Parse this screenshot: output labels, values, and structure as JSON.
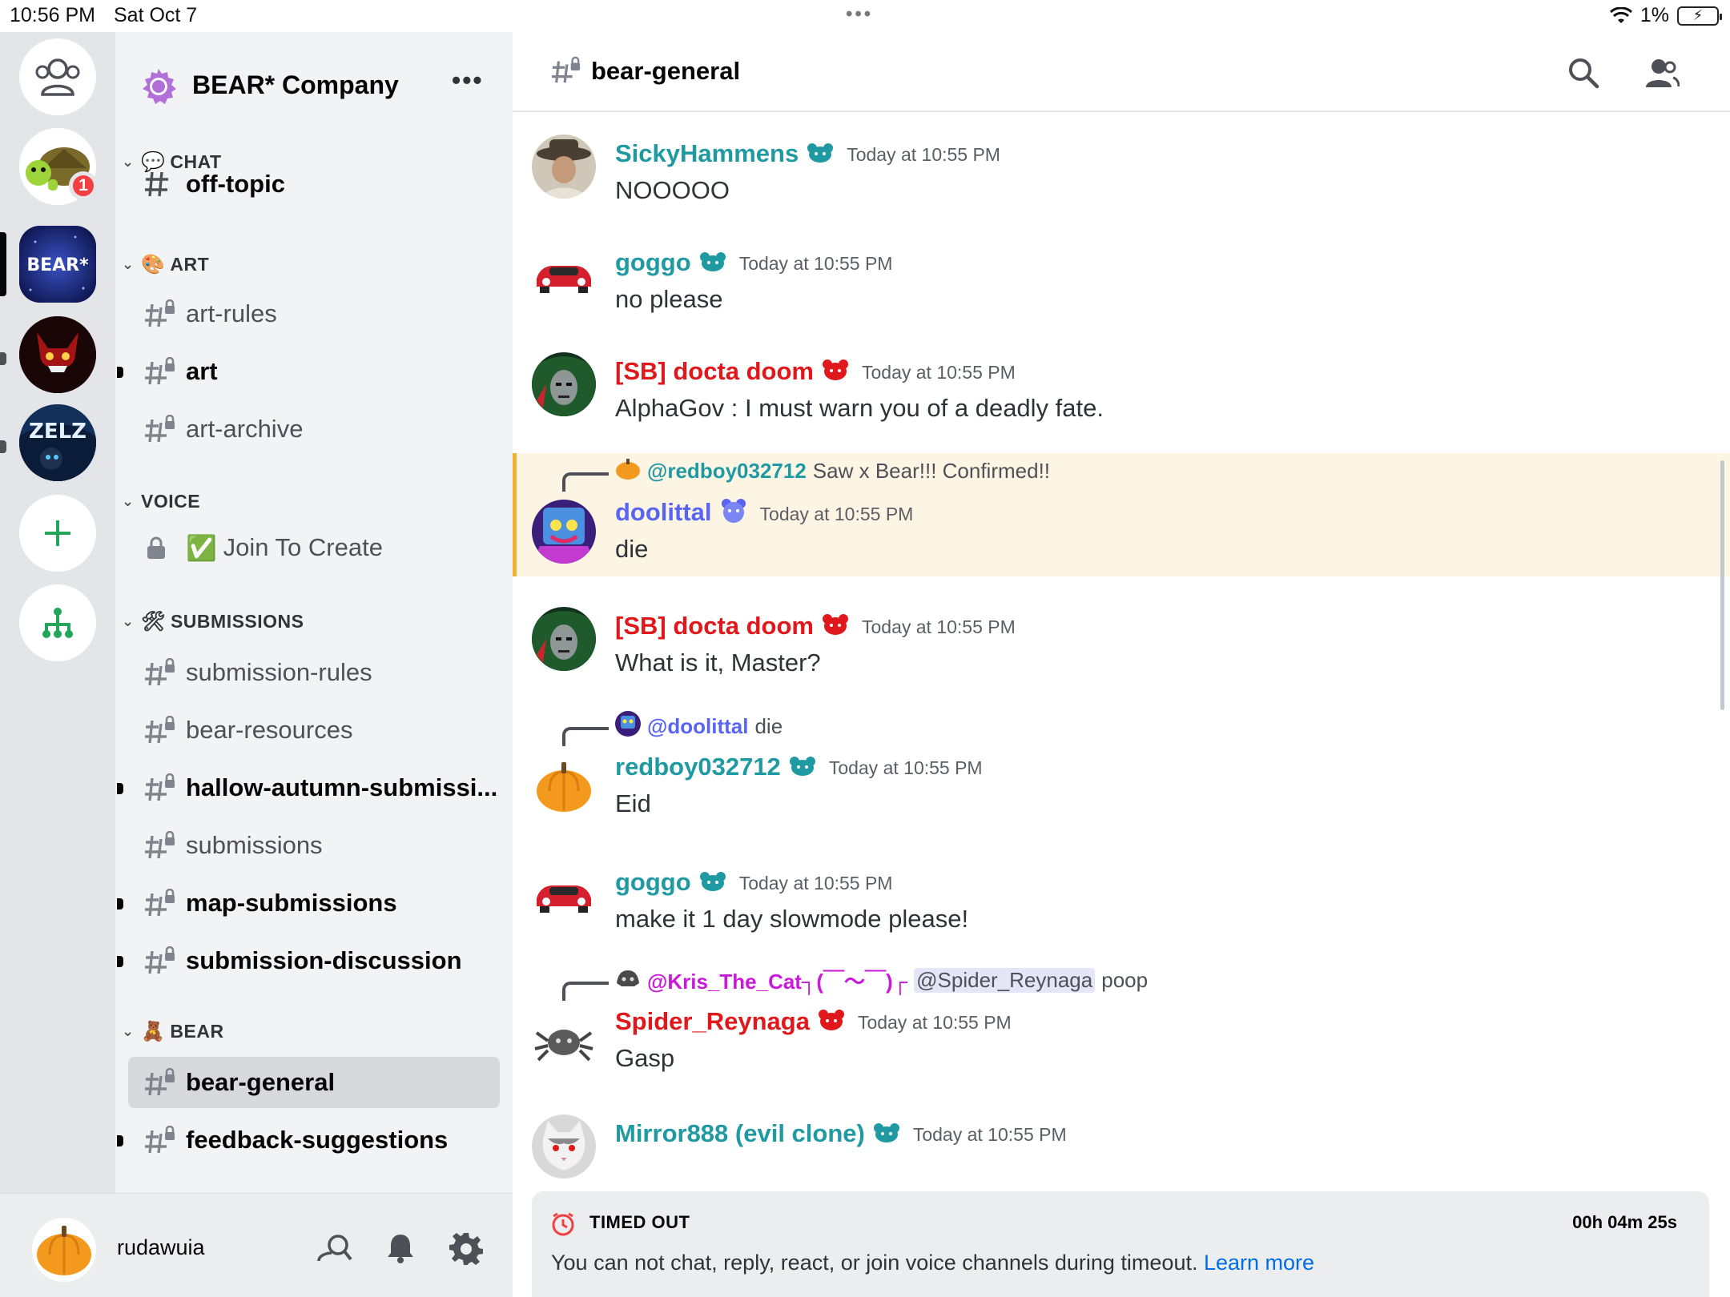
{
  "status_bar": {
    "time": "10:56 PM",
    "date": "Sat Oct 7",
    "battery": "1%"
  },
  "rail": {
    "servers": [
      {
        "name": "direct-messages",
        "badge": ""
      },
      {
        "name": "turtle-server",
        "badge": "1"
      },
      {
        "name": "bear-company",
        "label": "BEAR*"
      },
      {
        "name": "red-demon-server"
      },
      {
        "name": "zelz-server",
        "label": "ZELZ"
      }
    ]
  },
  "guild": {
    "name": "BEAR* Company",
    "more": "•••"
  },
  "categories": {
    "chat": {
      "label": "CHAT",
      "emoji": "💬"
    },
    "art": {
      "label": "ART",
      "emoji": "🎨"
    },
    "voice": {
      "label": "VOICE"
    },
    "submissions": {
      "label": "SUBMISSIONS",
      "emoji": "🛠"
    },
    "bear": {
      "label": "BEAR",
      "emoji": "🧸"
    }
  },
  "channels": {
    "off_topic": "off-topic",
    "art_rules": "art-rules",
    "art": "art",
    "art_archive": "art-archive",
    "join_to_create": "Join To Create",
    "join_emoji": "✅",
    "submission_rules": "submission-rules",
    "bear_resources": "bear-resources",
    "hallow_autumn": "hallow-autumn-submissi...",
    "submissions": "submissions",
    "map_submissions": "map-submissions",
    "submission_discussion": "submission-discussion",
    "bear_general": "bear-general",
    "feedback_suggestions": "feedback-suggestions"
  },
  "user": {
    "name": "rudawuia"
  },
  "header": {
    "channel": "bear-general"
  },
  "messages": [
    {
      "author": "SickyHammens",
      "color": "#1f9aa3",
      "time": "Today at 10:55 PM",
      "text": "NOOOOO"
    },
    {
      "author": "goggo",
      "color": "#1f9aa3",
      "time": "Today at 10:55 PM",
      "text": "no please"
    },
    {
      "author": "[SB] docta doom",
      "color": "#e0181b",
      "time": "Today at 10:55 PM",
      "text": "AlphaGov : I must warn you of a deadly fate."
    },
    {
      "reply_name": "@redboy032712",
      "reply_text": "Saw x Bear!!! Confirmed!!",
      "author": "doolittal",
      "color": "#5865f2",
      "time": "Today at 10:55 PM",
      "text": "die"
    },
    {
      "author": "[SB] docta doom",
      "color": "#e0181b",
      "time": "Today at 10:55 PM",
      "text": "What is it, Master?"
    },
    {
      "reply_name": "@doolittal",
      "reply_text": "die",
      "author": "redboy032712",
      "color": "#1f9aa3",
      "time": "Today at 10:55 PM",
      "text": "Eid"
    },
    {
      "author": "goggo",
      "color": "#1f9aa3",
      "time": "Today at 10:55 PM",
      "text": "make it 1 day slowmode please!"
    },
    {
      "reply_name": "@Kris_The_Cat┐(￣～￣)┌",
      "reply_mention": "@Spider_Reynaga",
      "reply_text": "poop",
      "author": "Spider_Reynaga",
      "color": "#e0181b",
      "time": "Today at 10:55 PM",
      "text": "Gasp"
    },
    {
      "author": "Mirror888 (evil clone)",
      "color": "#1f9aa3",
      "time": "Today at 10:55 PM",
      "text": ""
    }
  ],
  "timeout": {
    "title": "TIMED OUT",
    "countdown": "00h 04m 25s",
    "message": "You can not chat, reply, react, or join voice channels during timeout.",
    "link": "Learn more"
  },
  "colors": {
    "accent_teal": "#1f9aa3",
    "role_red": "#e0181b",
    "blurple": "#5865f2",
    "magenta": "#c81ad8",
    "link": "#006ce7"
  }
}
